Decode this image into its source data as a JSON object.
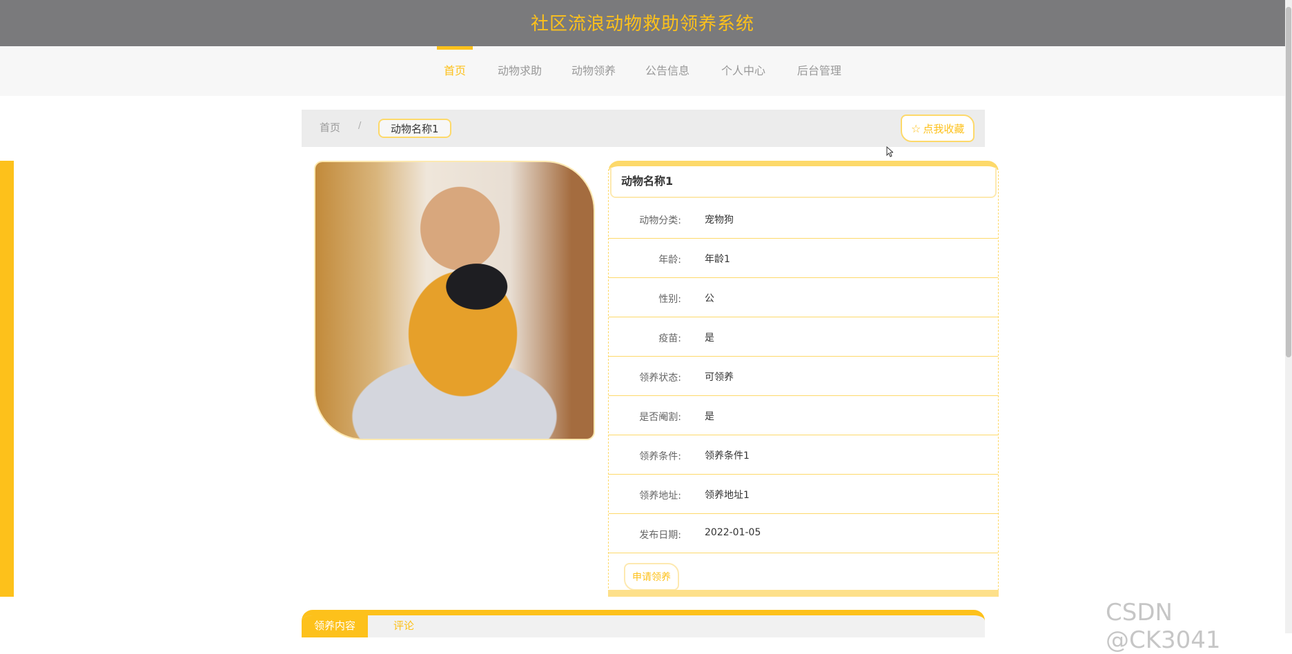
{
  "header": {
    "site_title": "社区流浪动物救助领养系统"
  },
  "nav": {
    "items": [
      {
        "label": "首页",
        "active": true
      },
      {
        "label": "动物求助",
        "active": false
      },
      {
        "label": "动物领养",
        "active": false
      },
      {
        "label": "公告信息",
        "active": false
      },
      {
        "label": "个人中心",
        "active": false
      },
      {
        "label": "后台管理",
        "active": false
      }
    ]
  },
  "breadcrumb": {
    "home": "首页",
    "separator": "/",
    "current": "动物名称1"
  },
  "favorite": {
    "icon": "star-icon",
    "label": "点我收藏"
  },
  "detail": {
    "title": "动物名称1",
    "fields": [
      {
        "label": "动物分类:",
        "value": "宠物狗"
      },
      {
        "label": "年龄:",
        "value": "年龄1"
      },
      {
        "label": "性别:",
        "value": "公"
      },
      {
        "label": "疫苗:",
        "value": "是"
      },
      {
        "label": "领养状态:",
        "value": "可领养"
      },
      {
        "label": "是否阉割:",
        "value": "是"
      },
      {
        "label": "领养条件:",
        "value": "领养条件1"
      },
      {
        "label": "领养地址:",
        "value": "领养地址1"
      },
      {
        "label": "发布日期:",
        "value": "2022-01-05"
      }
    ],
    "apply_label": "申请领养"
  },
  "tabs": [
    {
      "label": "领养内容",
      "active": true
    },
    {
      "label": "评论",
      "active": false
    }
  ],
  "watermark": "CSDN @CK3041",
  "colors": {
    "accent": "#fdc11b",
    "header_bg": "#7a7a7c",
    "border": "#fdd96a"
  }
}
